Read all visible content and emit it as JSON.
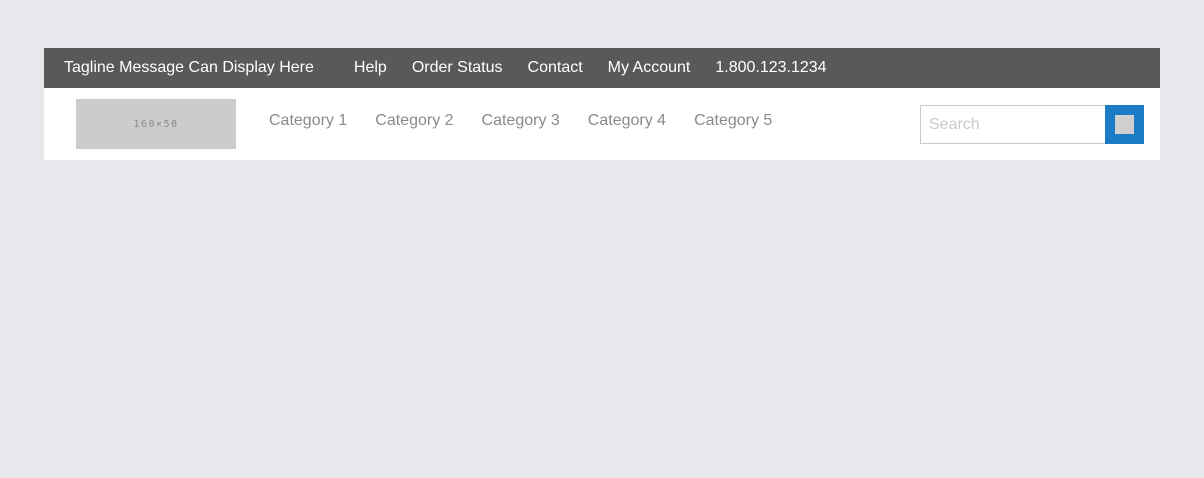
{
  "top_bar": {
    "tagline": "Tagline Message Can Display Here",
    "links": [
      {
        "label": "Help"
      },
      {
        "label": "Order Status"
      },
      {
        "label": "Contact"
      },
      {
        "label": "My Account"
      }
    ],
    "phone": "1.800.123.1234"
  },
  "header": {
    "logo_placeholder": "160×50",
    "categories": [
      {
        "label": "Category 1"
      },
      {
        "label": "Category 2"
      },
      {
        "label": "Category 3"
      },
      {
        "label": "Category 4"
      },
      {
        "label": "Category 5"
      }
    ],
    "search": {
      "placeholder": "Search",
      "value": "",
      "button_icon": "search-icon"
    }
  },
  "colors": {
    "page_background": "#e7e8ec",
    "top_bar_background": "#595959",
    "header_background": "#ffffff",
    "category_text": "#8a8a8a",
    "search_button": "#1b7bc4",
    "logo_placeholder": "#cccccc"
  }
}
